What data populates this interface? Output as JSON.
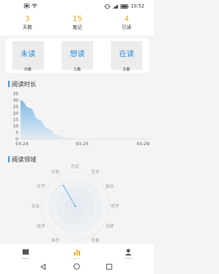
{
  "status_bar": {
    "time": "10:52",
    "left_icons": [
      "sim-icon",
      "wifi-icon"
    ],
    "right_icons": [
      "vibrate-icon",
      "signal-icon",
      "battery-icon"
    ]
  },
  "top_stats": [
    {
      "value": "3",
      "label": "天数"
    },
    {
      "value": "15",
      "label": "笔记"
    },
    {
      "value": "4",
      "label": "已读"
    }
  ],
  "reading_status": [
    {
      "title": "未读",
      "count": "0本"
    },
    {
      "title": "想读",
      "count": "1本"
    },
    {
      "title": "在读",
      "count": "2本"
    }
  ],
  "reading_time_section": {
    "title": "阅读时长"
  },
  "reading_domain_section": {
    "title": "阅读领域"
  },
  "chart_data": [
    {
      "type": "area",
      "title": "阅读时长",
      "x": [
        "03-24",
        "03-25",
        "03-29"
      ],
      "y_ticks": [
        0,
        5,
        10,
        15,
        20,
        25,
        30,
        35
      ],
      "ylim": [
        0,
        35
      ],
      "series": [
        {
          "values": [
            30,
            24,
            15,
            8,
            3,
            1,
            0,
            0
          ]
        }
      ],
      "x_tick_labels": [
        "03-24",
        "03-25",
        "03-29"
      ],
      "grid": false
    },
    {
      "type": "radar",
      "title": "阅读领域",
      "categories": [
        "历史",
        "艺术",
        "政治",
        "哲学",
        "法律",
        "军事",
        "天文",
        "科学",
        "经济",
        "农业",
        "文学",
        "社科"
      ],
      "values": [
        0,
        0,
        0,
        0,
        0,
        0,
        0,
        0,
        0,
        0,
        0,
        1
      ]
    }
  ],
  "tabbar": [
    {
      "label": "书架",
      "icon": "bookshelf-icon",
      "active": false
    },
    {
      "label": "统计",
      "icon": "chart-icon",
      "active": true
    },
    {
      "label": "我的",
      "icon": "user-icon",
      "active": false
    }
  ],
  "colors": {
    "accent": "#e7a81f",
    "blue": "#2b8cd8",
    "area_fill": "#7ab8e6"
  }
}
